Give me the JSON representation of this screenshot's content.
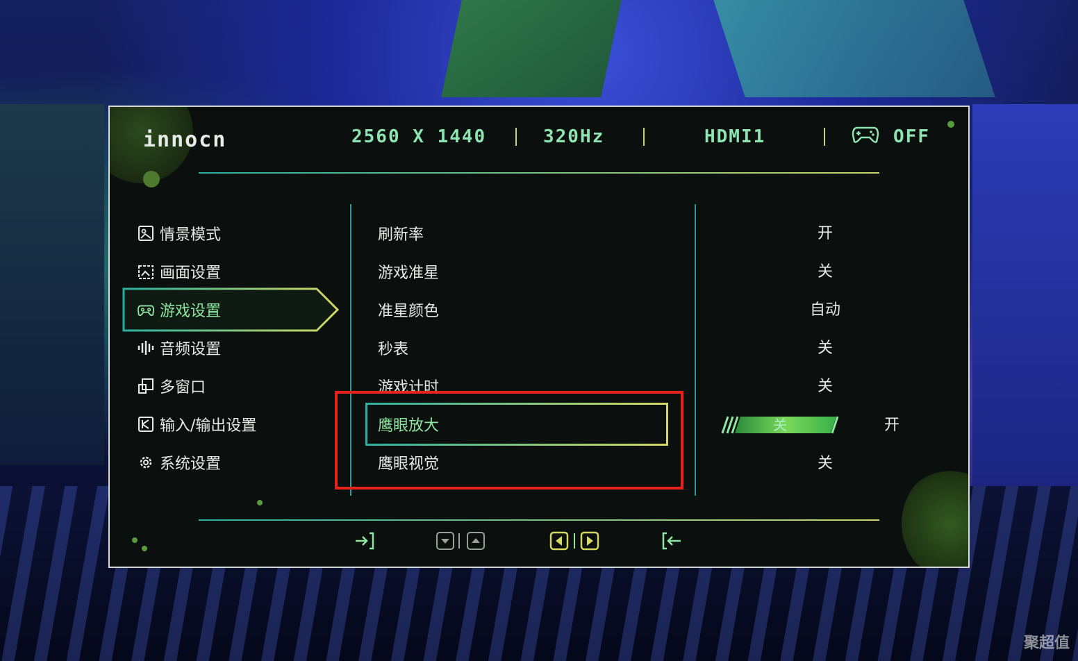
{
  "header": {
    "brand": "innocn",
    "resolution": "2560 X 1440",
    "refresh_rate": "320Hz",
    "input": "HDMI1",
    "game_mode_status": "OFF"
  },
  "main_menu": [
    {
      "label": "情景模式",
      "icon": "picture-icon"
    },
    {
      "label": "画面设置",
      "icon": "image-settings-icon"
    },
    {
      "label": "游戏设置",
      "icon": "gamepad-icon",
      "active": true
    },
    {
      "label": "音频设置",
      "icon": "audio-bars-icon"
    },
    {
      "label": "多窗口",
      "icon": "multi-window-icon"
    },
    {
      "label": "输入/输出设置",
      "icon": "input-output-icon"
    },
    {
      "label": "系统设置",
      "icon": "gear-icon"
    }
  ],
  "sub_menu": [
    {
      "label": "刷新率",
      "value": "开"
    },
    {
      "label": "游戏准星",
      "value": "关"
    },
    {
      "label": "准星颜色",
      "value": "自动"
    },
    {
      "label": "秒表",
      "value": "关"
    },
    {
      "label": "游戏计时",
      "value": "关"
    },
    {
      "label": "鹰眼放大",
      "value": "开",
      "active": true,
      "slider_value": "关"
    },
    {
      "label": "鹰眼视觉",
      "value": "关"
    }
  ],
  "nav_buttons": [
    "enter-icon",
    "down-icon",
    "up-icon",
    "left-icon",
    "right-icon",
    "exit-icon"
  ],
  "watermark": "聚超值",
  "colors": {
    "accent_green": "#8ee6a0",
    "accent_yellow": "#d4d860",
    "highlight_red": "#e8231c"
  }
}
